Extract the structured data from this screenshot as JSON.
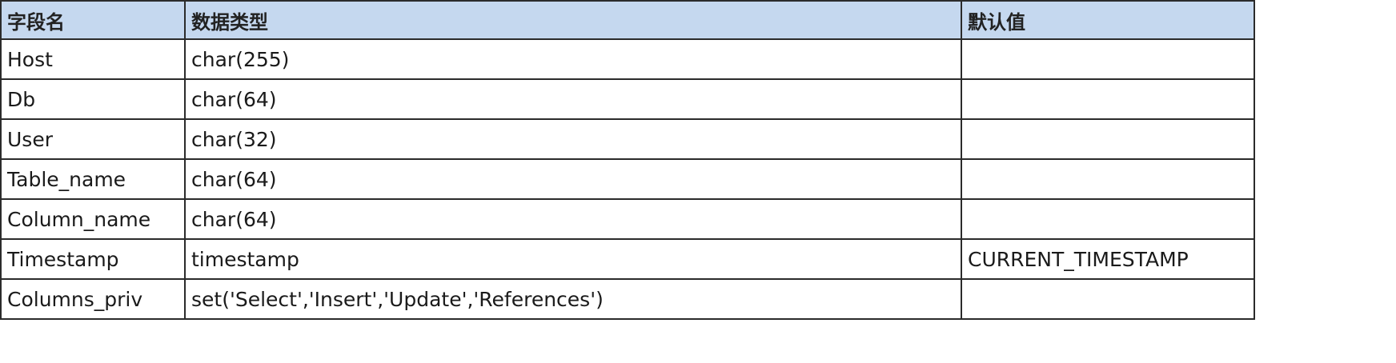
{
  "table": {
    "headers": [
      "字段名",
      "数据类型",
      "默认值"
    ],
    "rows": [
      [
        "Host",
        "char(255)",
        ""
      ],
      [
        "Db",
        "char(64)",
        ""
      ],
      [
        "User",
        "char(32)",
        ""
      ],
      [
        "Table_name",
        "char(64)",
        ""
      ],
      [
        "Column_name",
        "char(64)",
        ""
      ],
      [
        "Timestamp",
        "timestamp",
        "CURRENT_TIMESTAMP"
      ],
      [
        "Columns_priv",
        "set('Select','Insert','Update','References')",
        ""
      ]
    ]
  },
  "colors": {
    "header_bg": "#c5d8ef",
    "border": "#2b2b2b",
    "text": "#1a1a1a"
  }
}
